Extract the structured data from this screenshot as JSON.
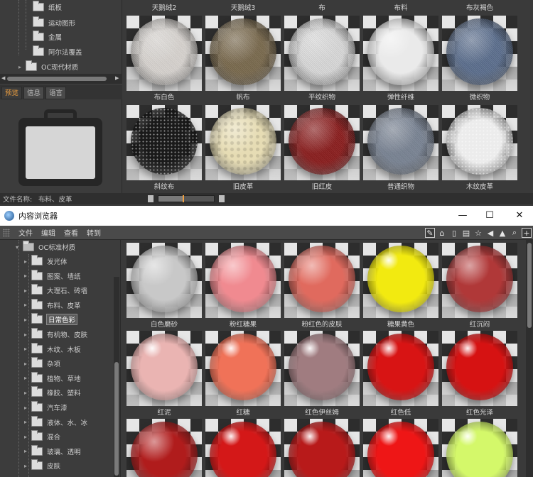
{
  "top_browser": {
    "tree_items": [
      {
        "label": "纸板"
      },
      {
        "label": "运动图形"
      },
      {
        "label": "金属"
      },
      {
        "label": "阿尔法覆盖"
      },
      {
        "label": "OC现代材质"
      }
    ],
    "preview_tabs": [
      "预览",
      "信息",
      "语言"
    ],
    "status": {
      "label": "文件名称:",
      "value": "布料、皮革"
    },
    "top_labels": [
      "天鹅绒2",
      "天鹅绒3",
      "布",
      "布料",
      "布灰褐色"
    ],
    "rows": [
      [
        {
          "label": "布白色",
          "color": "#d8d4d0",
          "texture": "noise"
        },
        {
          "label": "帆布",
          "color": "#7a6a4e",
          "texture": "weave"
        },
        {
          "label": "平纹织物",
          "color": "#d9d9d9",
          "texture": "noise"
        },
        {
          "label": "弹性纤维",
          "color": "#eaeaea",
          "texture": "smooth"
        },
        {
          "label": "微织物",
          "color": "#5c6f8e",
          "texture": "noise"
        }
      ],
      [
        {
          "label": "斜纹布",
          "color": "#1a1a1a",
          "texture": "sparkle"
        },
        {
          "label": "旧皮革",
          "color": "#e6dcb4",
          "texture": "bumps"
        },
        {
          "label": "旧红皮",
          "color": "#8b1e1e",
          "texture": "noise"
        },
        {
          "label": "普通织物",
          "color": "#7a8494",
          "texture": "noise"
        },
        {
          "label": "木纹皮革",
          "color": "#ececec",
          "texture": "sparkle"
        }
      ]
    ]
  },
  "window": {
    "title": "内容浏览器",
    "controls": {
      "minimize": "—",
      "maximize": "☐",
      "close": "✕"
    },
    "menu": [
      "文件",
      "编辑",
      "查看",
      "转到"
    ],
    "toolbar_icons": [
      "pencil-icon",
      "home-icon",
      "lock-icon",
      "book-icon",
      "star-icon",
      "back-icon",
      "forward-icon",
      "search-icon",
      "add-icon"
    ],
    "tree": {
      "root": "OC标准材质",
      "items": [
        {
          "label": "发光体"
        },
        {
          "label": "图案、墙纸"
        },
        {
          "label": "大理石、砖墙"
        },
        {
          "label": "布料、皮革"
        },
        {
          "label": "日常色彩",
          "selected": true
        },
        {
          "label": "有机物、皮肤"
        },
        {
          "label": "木纹、木板"
        },
        {
          "label": "杂项"
        },
        {
          "label": "植物、草地"
        },
        {
          "label": "橡胶、塑料"
        },
        {
          "label": "汽车漆"
        },
        {
          "label": "液体、水、冰"
        },
        {
          "label": "混合"
        },
        {
          "label": "玻璃、透明"
        },
        {
          "label": "皮肤"
        }
      ]
    },
    "rows": [
      [
        {
          "label": "白色磨砂",
          "color": "#c8c8c8",
          "texture": "matte"
        },
        {
          "label": "粉红糖果",
          "color": "#f08a90",
          "texture": "matte"
        },
        {
          "label": "粉红色的皮肤",
          "color": "#e06a5e",
          "texture": "matte"
        },
        {
          "label": "糖果黄色",
          "color": "#f2ea10",
          "texture": "gloss"
        },
        {
          "label": "红沉闷",
          "color": "#b03838",
          "texture": "matte"
        }
      ],
      [
        {
          "label": "红泥",
          "color": "#eab4b2",
          "texture": "gloss"
        },
        {
          "label": "红糖",
          "color": "#f07258",
          "texture": "gloss"
        },
        {
          "label": "红色伊丝姆",
          "color": "#a07c80",
          "texture": "gloss"
        },
        {
          "label": "红色低",
          "color": "#d81414",
          "texture": "gloss"
        },
        {
          "label": "红色光泽",
          "color": "#d61212",
          "texture": "gloss"
        }
      ],
      [
        {
          "label": "",
          "color": "#b01c1c",
          "texture": "matte"
        },
        {
          "label": "",
          "color": "#d41818",
          "texture": "gloss"
        },
        {
          "label": "",
          "color": "#b81a1a",
          "texture": "gloss"
        },
        {
          "label": "",
          "color": "#ee1616",
          "texture": "gloss"
        },
        {
          "label": "",
          "color": "#d4f86a",
          "texture": "gloss"
        }
      ]
    ]
  }
}
